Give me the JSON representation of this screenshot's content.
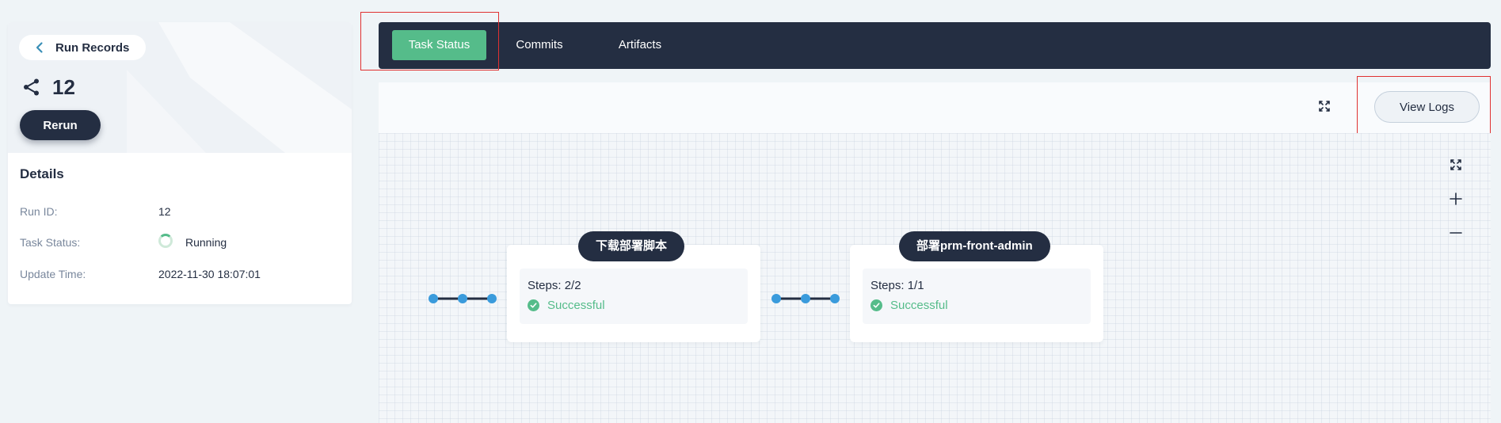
{
  "left_panel": {
    "back_label": "Run Records",
    "run_number": "12",
    "rerun_label": "Rerun",
    "details_title": "Details",
    "details": [
      {
        "label": "Run ID:",
        "value": "12"
      },
      {
        "label": "Task Status:",
        "value": "Running"
      },
      {
        "label": "Update Time:",
        "value": "2022-11-30 18:07:01"
      }
    ]
  },
  "tabs": [
    {
      "label": "Task Status",
      "active": true
    },
    {
      "label": "Commits",
      "active": false
    },
    {
      "label": "Artifacts",
      "active": false
    }
  ],
  "toolbar": {
    "view_logs_label": "View Logs"
  },
  "pipeline": {
    "stages": [
      {
        "title": "下载部署脚本",
        "steps": "Steps: 2/2",
        "status": "Successful"
      },
      {
        "title": "部署prm-front-admin",
        "steps": "Steps: 1/1",
        "status": "Successful"
      }
    ]
  },
  "colors": {
    "dark": "#242e42",
    "accent_green": "#55bc8a",
    "connector_blue": "#3a9bdc",
    "highlight_red": "#e03131"
  }
}
